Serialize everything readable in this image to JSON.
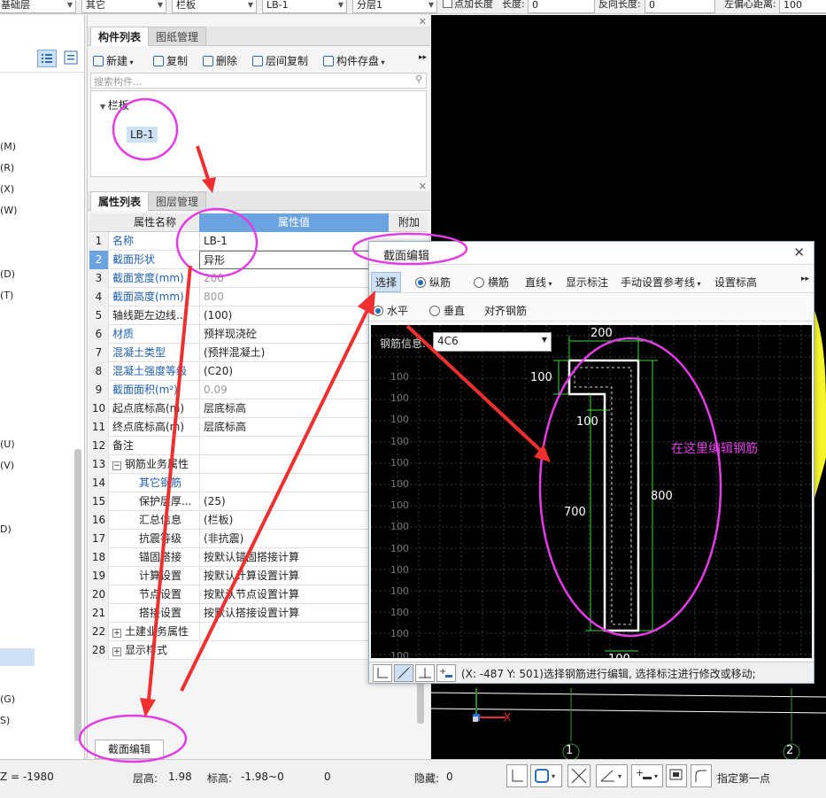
{
  "topbar": {
    "combo1": "基础层",
    "combo2": "其它",
    "combo3": "栏板",
    "combo4": "LB-1",
    "combo5": "分层1",
    "point_length": "点加长度",
    "length_label": "长度:",
    "length_value": "0",
    "reverse_length_label": "反向长度:",
    "reverse_length_value": "0",
    "left_offset_label": "左偏心距离:",
    "left_offset_value": "100"
  },
  "left_panel": {
    "letters": [
      "(M)",
      "(R)",
      "(X)",
      "(W)",
      "(D)",
      "(T)",
      "(U)",
      "(V)",
      "D)",
      "(G)",
      "S)"
    ]
  },
  "component_panel": {
    "tab_active": "构件列表",
    "tab_inactive": "图纸管理",
    "toolbar": {
      "new": "新建",
      "copy": "复制",
      "delete": "删除",
      "floor_copy": "层间复制",
      "save": "构件存盘"
    },
    "search_placeholder": "搜索构件...",
    "tree_root": "栏板",
    "tree_item": "LB-1"
  },
  "property_panel": {
    "tab_active": "属性列表",
    "tab_inactive": "图层管理",
    "header_name": "属性名称",
    "header_value": "属性值",
    "header_extra": "附加",
    "rows": [
      {
        "num": "1",
        "name": "名称",
        "value": "LB-1"
      },
      {
        "num": "2",
        "name": "截面形状",
        "value": "异形"
      },
      {
        "num": "3",
        "name": "截面宽度(mm)",
        "value": "200"
      },
      {
        "num": "4",
        "name": "截面高度(mm)",
        "value": "800"
      },
      {
        "num": "5",
        "name": "轴线距左边线...",
        "value": "(100)"
      },
      {
        "num": "6",
        "name": "材质",
        "value": "预拌现浇砼"
      },
      {
        "num": "7",
        "name": "混凝土类型",
        "value": "(预拌混凝土)"
      },
      {
        "num": "8",
        "name": "混凝土强度等级",
        "value": "(C20)"
      },
      {
        "num": "9",
        "name": "截面面积(m²)",
        "value": "0.09"
      },
      {
        "num": "10",
        "name": "起点底标高(m)",
        "value": "层底标高"
      },
      {
        "num": "11",
        "name": "终点底标高(m)",
        "value": "层底标高"
      },
      {
        "num": "12",
        "name": "备注",
        "value": ""
      },
      {
        "num": "13",
        "name": "钢筋业务属性",
        "value": ""
      },
      {
        "num": "14",
        "name": "其它钢筋",
        "value": ""
      },
      {
        "num": "15",
        "name": "保护层厚...",
        "value": "(25)"
      },
      {
        "num": "16",
        "name": "汇总信息",
        "value": "(栏板)"
      },
      {
        "num": "17",
        "name": "抗震等级",
        "value": "(非抗震)"
      },
      {
        "num": "18",
        "name": "锚固搭接",
        "value": "按默认锚固搭接计算"
      },
      {
        "num": "19",
        "name": "计算设置",
        "value": "按默认计算设置计算"
      },
      {
        "num": "20",
        "name": "节点设置",
        "value": "按默认节点设置计算"
      },
      {
        "num": "21",
        "name": "搭接设置",
        "value": "按默认搭接设置计算"
      },
      {
        "num": "22",
        "name": "土建业务属性",
        "value": ""
      },
      {
        "num": "28",
        "name": "显示样式",
        "value": ""
      }
    ],
    "edit_button": "截面编辑"
  },
  "dialog": {
    "title": "截面编辑",
    "toolbar1": {
      "select": "选择",
      "longitudinal": "纵筋",
      "transverse": "横筋",
      "line": "直线",
      "show_dim": "显示标注",
      "manual_ref": "手动设置参考线",
      "set_elev": "设置标高"
    },
    "toolbar2": {
      "horizontal": "水平",
      "vertical": "垂直",
      "align": "对齐钢筋"
    },
    "rebar_label": "钢筋信息:",
    "rebar_value": "4C6",
    "grid_label": "100",
    "dims": {
      "top": "200",
      "left_top": "100",
      "inner": "100",
      "left": "700",
      "right": "800",
      "bottom": "100"
    },
    "status": "(X: -487 Y: 501)选择钢筋进行编辑, 选择标注进行修改或移动;"
  },
  "annotation_text": "在这里编辑钢筋",
  "bottom": {
    "z": "Z = -1980",
    "floor_label": "层高:",
    "floor_value": "1.98",
    "elev_label": "标高:",
    "elev_value": "-1.98~0",
    "zero": "0",
    "hidden_label": "隐藏:",
    "hidden_value": "0",
    "point_hint": "指定第一点"
  },
  "canvas": {
    "axis1": "1",
    "axis2": "2",
    "axis_x": "X"
  },
  "colors": {
    "annotation": "#e23ce6",
    "arrow": "#f03030",
    "rebar": "#ffffff",
    "dimension": "#39d839",
    "header_blue": "#6aa3e0"
  }
}
